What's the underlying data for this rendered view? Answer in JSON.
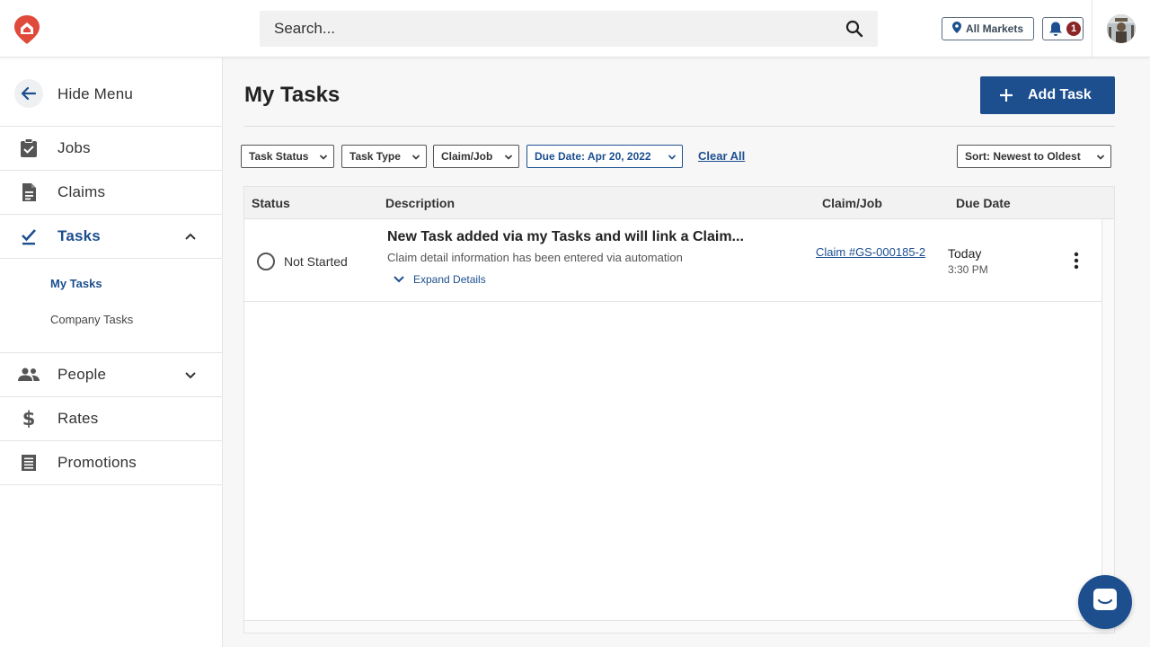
{
  "header": {
    "search": {
      "placeholder": "Search..."
    },
    "market_label": "All Markets",
    "notification_count": "1"
  },
  "sidebar": {
    "hide_menu_label": "Hide Menu",
    "items": [
      {
        "label": "Jobs",
        "icon": "clipboard-check-icon"
      },
      {
        "label": "Claims",
        "icon": "document-icon"
      },
      {
        "label": "Tasks",
        "icon": "check-icon",
        "expanded": true
      },
      {
        "label": "People",
        "icon": "people-icon",
        "expanded": false
      },
      {
        "label": "Rates",
        "icon": "dollar-icon"
      },
      {
        "label": "Promotions",
        "icon": "receipt-icon"
      }
    ],
    "task_subitems": [
      {
        "label": "My Tasks",
        "active": true
      },
      {
        "label": "Company Tasks",
        "active": false
      }
    ]
  },
  "main": {
    "title": "My Tasks",
    "add_button_label": "Add Task",
    "filters": [
      {
        "label": "Task Status"
      },
      {
        "label": "Task Type"
      },
      {
        "label": "Claim/Job"
      },
      {
        "label": "Due Date: Apr 20, 2022",
        "active": true
      }
    ],
    "clear_all_label": "Clear All",
    "sort_label": "Sort: Newest to Oldest",
    "table": {
      "columns": [
        "Status",
        "Description",
        "Claim/Job",
        "Due Date"
      ],
      "rows": [
        {
          "status": "Not Started",
          "title": "New Task added via my Tasks and will link a Claim...",
          "description": "Claim detail information has been entered via automation",
          "expand_label": "Expand Details",
          "claim_link": "Claim #GS-000185-2",
          "due_day": "Today",
          "due_time": "3:30 PM"
        }
      ]
    }
  },
  "colors": {
    "primary": "#1d4f8f",
    "brand": "#e04a3a",
    "badge": "#8b2626"
  }
}
